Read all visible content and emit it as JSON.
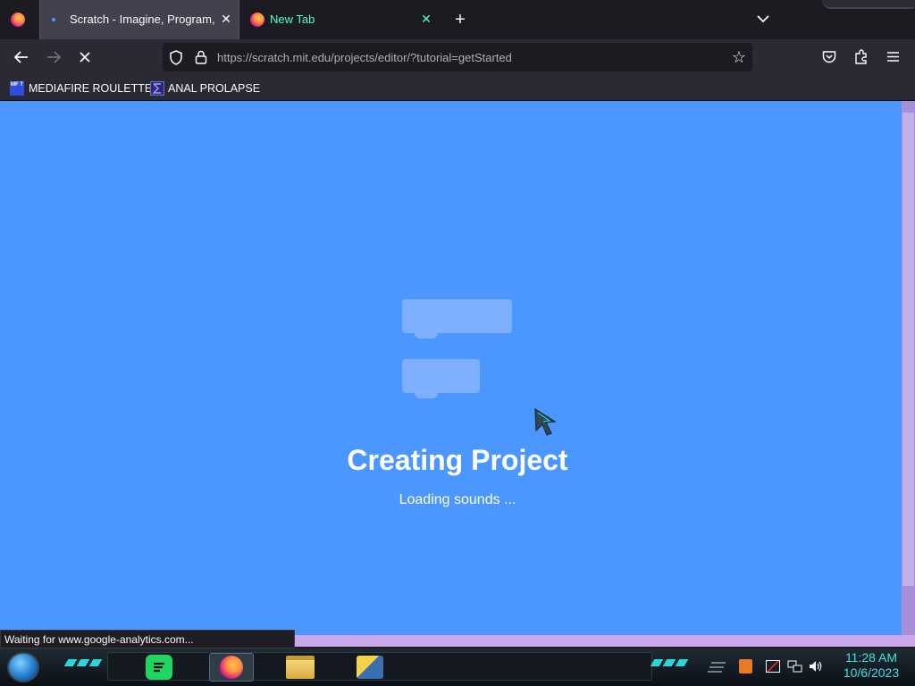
{
  "browser": {
    "tabs": [
      {
        "title": "Scratch - Imagine, Program, Sh",
        "active": true
      },
      {
        "title": "New Tab",
        "active": false
      }
    ],
    "url": "https://scratch.mit.edu/projects/editor/?tutorial=getStarted"
  },
  "bookmarks": [
    {
      "label": "MEDIAFIRE ROULETTER",
      "icon": "MF T"
    },
    {
      "label": "ANAL PROLAPSE",
      "icon": "sigma"
    }
  ],
  "page": {
    "title": "Creating Project",
    "subtitle": "Loading sounds ..."
  },
  "status_text": "Waiting for www.google-analytics.com...",
  "taskbar": {
    "time": "11:28 AM",
    "date": "10/6/2023"
  },
  "colors": {
    "scratch_blue": "#4c97ff",
    "clock_cyan": "#36e3e7",
    "new_tab_green": "#54ffbd"
  }
}
